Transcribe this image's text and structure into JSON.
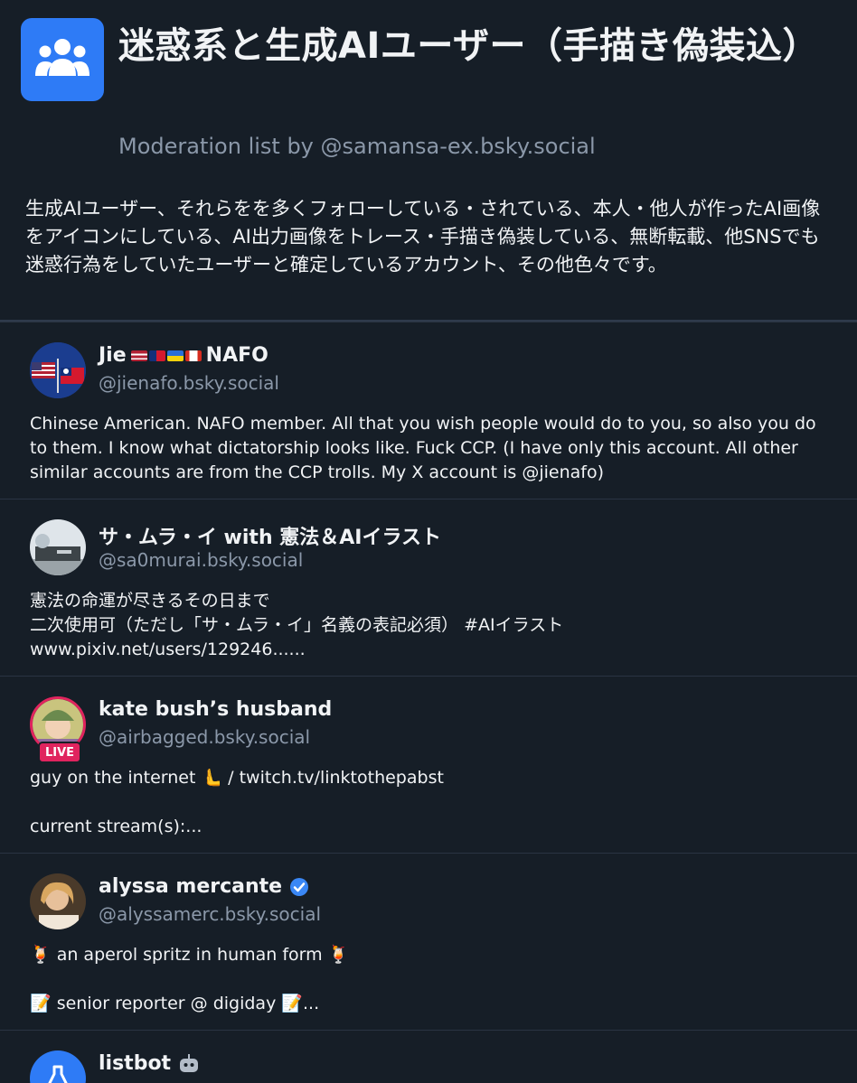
{
  "list": {
    "title": "迷惑系と生成AIユーザー（手描き偽装込）",
    "subtitle": "Moderation list by @samansa-ex.bsky.social",
    "description": "生成AIユーザー、それらをを多くフォローしている・されている、本人・他人が作ったAI画像をアイコンにしている、AI出力画像をトレース・手描き偽装している、無断転載、他SNSでも迷惑行為をしていたユーザーと確定しているアカウント、その他色々です。",
    "avatar_icon": "people-group-icon",
    "accent_color": "#2e7bf6"
  },
  "members": [
    {
      "name_prefix": "Jie",
      "name_suffix": "NAFO",
      "handle": "@jienafo.bsky.social",
      "bio": "Chinese American. NAFO member. All that you wish people would do to you, so also you do to them. I know what dictatorship looks like. Fuck CCP. (I have only this account. All other similar accounts are from the CCP trolls. My X account is @jienafo)"
    },
    {
      "name": "サ・ムラ・イ with 憲法＆AIイラスト",
      "handle": "@sa0murai.bsky.social",
      "bio": "憲法の命運が尽きるその日まで\n二次使用可（ただし「サ・ムラ・イ」名義の表記必須） #AIイラスト\nwww.pixiv.net/users/129246......"
    },
    {
      "name": "kate bush’s husband",
      "handle": "@airbagged.bsky.social",
      "badge": "LIVE",
      "bio": "guy on the internet 🫷 / twitch.tv/linktothepabst\n\ncurrent stream(s):..."
    },
    {
      "name": "alyssa mercante",
      "handle": "@alyssamerc.bsky.social",
      "bio": "🍹 an aperol spritz in human form 🍹\n\n📝 senior reporter @ digiday 📝..."
    },
    {
      "name": "listbot",
      "handle": "",
      "bio": ""
    }
  ],
  "colors": {
    "background": "#161e27",
    "muted_text": "#8b98a9",
    "live_badge": "#e0245e",
    "verified": "#3a87f5"
  }
}
